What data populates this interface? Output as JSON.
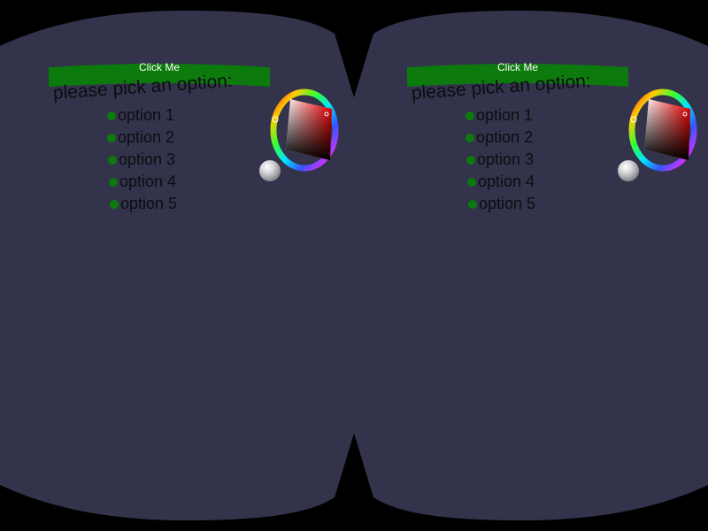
{
  "colors": {
    "background": "#000000",
    "lens": "#33334b",
    "button": "#0c7a0c",
    "button_text": "#ffffff",
    "text": "#0d0d12",
    "radio_dot": "#0c7a0c"
  },
  "eyes": [
    {
      "button_label": "Click Me",
      "prompt": "please pick an option:",
      "options": [
        "option 1",
        "option 2",
        "option 3",
        "option 4",
        "option 5"
      ]
    },
    {
      "button_label": "Click Me",
      "prompt": "please pick an option:",
      "options": [
        "option 1",
        "option 2",
        "option 3",
        "option 4",
        "option 5"
      ]
    }
  ],
  "icons": {
    "color_picker": "color-wheel-icon",
    "handle": "sphere-handle-icon"
  }
}
